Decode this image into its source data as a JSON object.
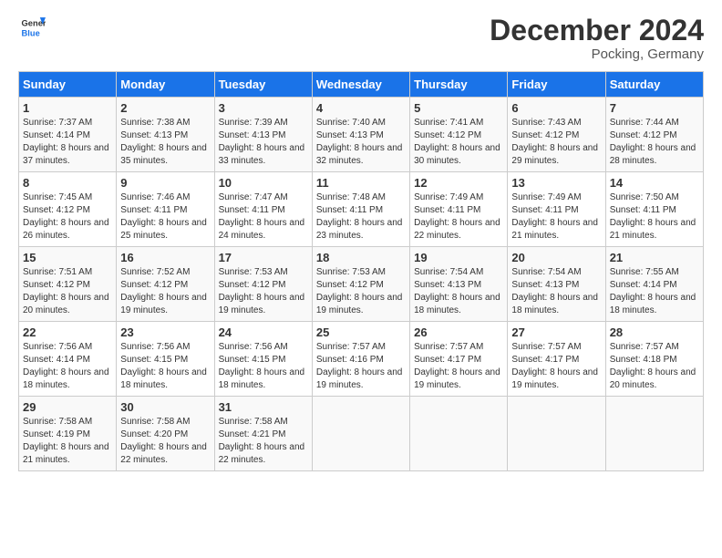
{
  "header": {
    "logo_line1": "General",
    "logo_line2": "Blue",
    "month_title": "December 2024",
    "location": "Pocking, Germany"
  },
  "days_of_week": [
    "Sunday",
    "Monday",
    "Tuesday",
    "Wednesday",
    "Thursday",
    "Friday",
    "Saturday"
  ],
  "weeks": [
    [
      {
        "day": "1",
        "sunrise": "7:37 AM",
        "sunset": "4:14 PM",
        "daylight": "8 hours and 37 minutes."
      },
      {
        "day": "2",
        "sunrise": "7:38 AM",
        "sunset": "4:13 PM",
        "daylight": "8 hours and 35 minutes."
      },
      {
        "day": "3",
        "sunrise": "7:39 AM",
        "sunset": "4:13 PM",
        "daylight": "8 hours and 33 minutes."
      },
      {
        "day": "4",
        "sunrise": "7:40 AM",
        "sunset": "4:13 PM",
        "daylight": "8 hours and 32 minutes."
      },
      {
        "day": "5",
        "sunrise": "7:41 AM",
        "sunset": "4:12 PM",
        "daylight": "8 hours and 30 minutes."
      },
      {
        "day": "6",
        "sunrise": "7:43 AM",
        "sunset": "4:12 PM",
        "daylight": "8 hours and 29 minutes."
      },
      {
        "day": "7",
        "sunrise": "7:44 AM",
        "sunset": "4:12 PM",
        "daylight": "8 hours and 28 minutes."
      }
    ],
    [
      {
        "day": "8",
        "sunrise": "7:45 AM",
        "sunset": "4:12 PM",
        "daylight": "8 hours and 26 minutes."
      },
      {
        "day": "9",
        "sunrise": "7:46 AM",
        "sunset": "4:11 PM",
        "daylight": "8 hours and 25 minutes."
      },
      {
        "day": "10",
        "sunrise": "7:47 AM",
        "sunset": "4:11 PM",
        "daylight": "8 hours and 24 minutes."
      },
      {
        "day": "11",
        "sunrise": "7:48 AM",
        "sunset": "4:11 PM",
        "daylight": "8 hours and 23 minutes."
      },
      {
        "day": "12",
        "sunrise": "7:49 AM",
        "sunset": "4:11 PM",
        "daylight": "8 hours and 22 minutes."
      },
      {
        "day": "13",
        "sunrise": "7:49 AM",
        "sunset": "4:11 PM",
        "daylight": "8 hours and 21 minutes."
      },
      {
        "day": "14",
        "sunrise": "7:50 AM",
        "sunset": "4:11 PM",
        "daylight": "8 hours and 21 minutes."
      }
    ],
    [
      {
        "day": "15",
        "sunrise": "7:51 AM",
        "sunset": "4:12 PM",
        "daylight": "8 hours and 20 minutes."
      },
      {
        "day": "16",
        "sunrise": "7:52 AM",
        "sunset": "4:12 PM",
        "daylight": "8 hours and 19 minutes."
      },
      {
        "day": "17",
        "sunrise": "7:53 AM",
        "sunset": "4:12 PM",
        "daylight": "8 hours and 19 minutes."
      },
      {
        "day": "18",
        "sunrise": "7:53 AM",
        "sunset": "4:12 PM",
        "daylight": "8 hours and 19 minutes."
      },
      {
        "day": "19",
        "sunrise": "7:54 AM",
        "sunset": "4:13 PM",
        "daylight": "8 hours and 18 minutes."
      },
      {
        "day": "20",
        "sunrise": "7:54 AM",
        "sunset": "4:13 PM",
        "daylight": "8 hours and 18 minutes."
      },
      {
        "day": "21",
        "sunrise": "7:55 AM",
        "sunset": "4:14 PM",
        "daylight": "8 hours and 18 minutes."
      }
    ],
    [
      {
        "day": "22",
        "sunrise": "7:56 AM",
        "sunset": "4:14 PM",
        "daylight": "8 hours and 18 minutes."
      },
      {
        "day": "23",
        "sunrise": "7:56 AM",
        "sunset": "4:15 PM",
        "daylight": "8 hours and 18 minutes."
      },
      {
        "day": "24",
        "sunrise": "7:56 AM",
        "sunset": "4:15 PM",
        "daylight": "8 hours and 18 minutes."
      },
      {
        "day": "25",
        "sunrise": "7:57 AM",
        "sunset": "4:16 PM",
        "daylight": "8 hours and 19 minutes."
      },
      {
        "day": "26",
        "sunrise": "7:57 AM",
        "sunset": "4:17 PM",
        "daylight": "8 hours and 19 minutes."
      },
      {
        "day": "27",
        "sunrise": "7:57 AM",
        "sunset": "4:17 PM",
        "daylight": "8 hours and 19 minutes."
      },
      {
        "day": "28",
        "sunrise": "7:57 AM",
        "sunset": "4:18 PM",
        "daylight": "8 hours and 20 minutes."
      }
    ],
    [
      {
        "day": "29",
        "sunrise": "7:58 AM",
        "sunset": "4:19 PM",
        "daylight": "8 hours and 21 minutes."
      },
      {
        "day": "30",
        "sunrise": "7:58 AM",
        "sunset": "4:20 PM",
        "daylight": "8 hours and 22 minutes."
      },
      {
        "day": "31",
        "sunrise": "7:58 AM",
        "sunset": "4:21 PM",
        "daylight": "8 hours and 22 minutes."
      },
      null,
      null,
      null,
      null
    ]
  ]
}
